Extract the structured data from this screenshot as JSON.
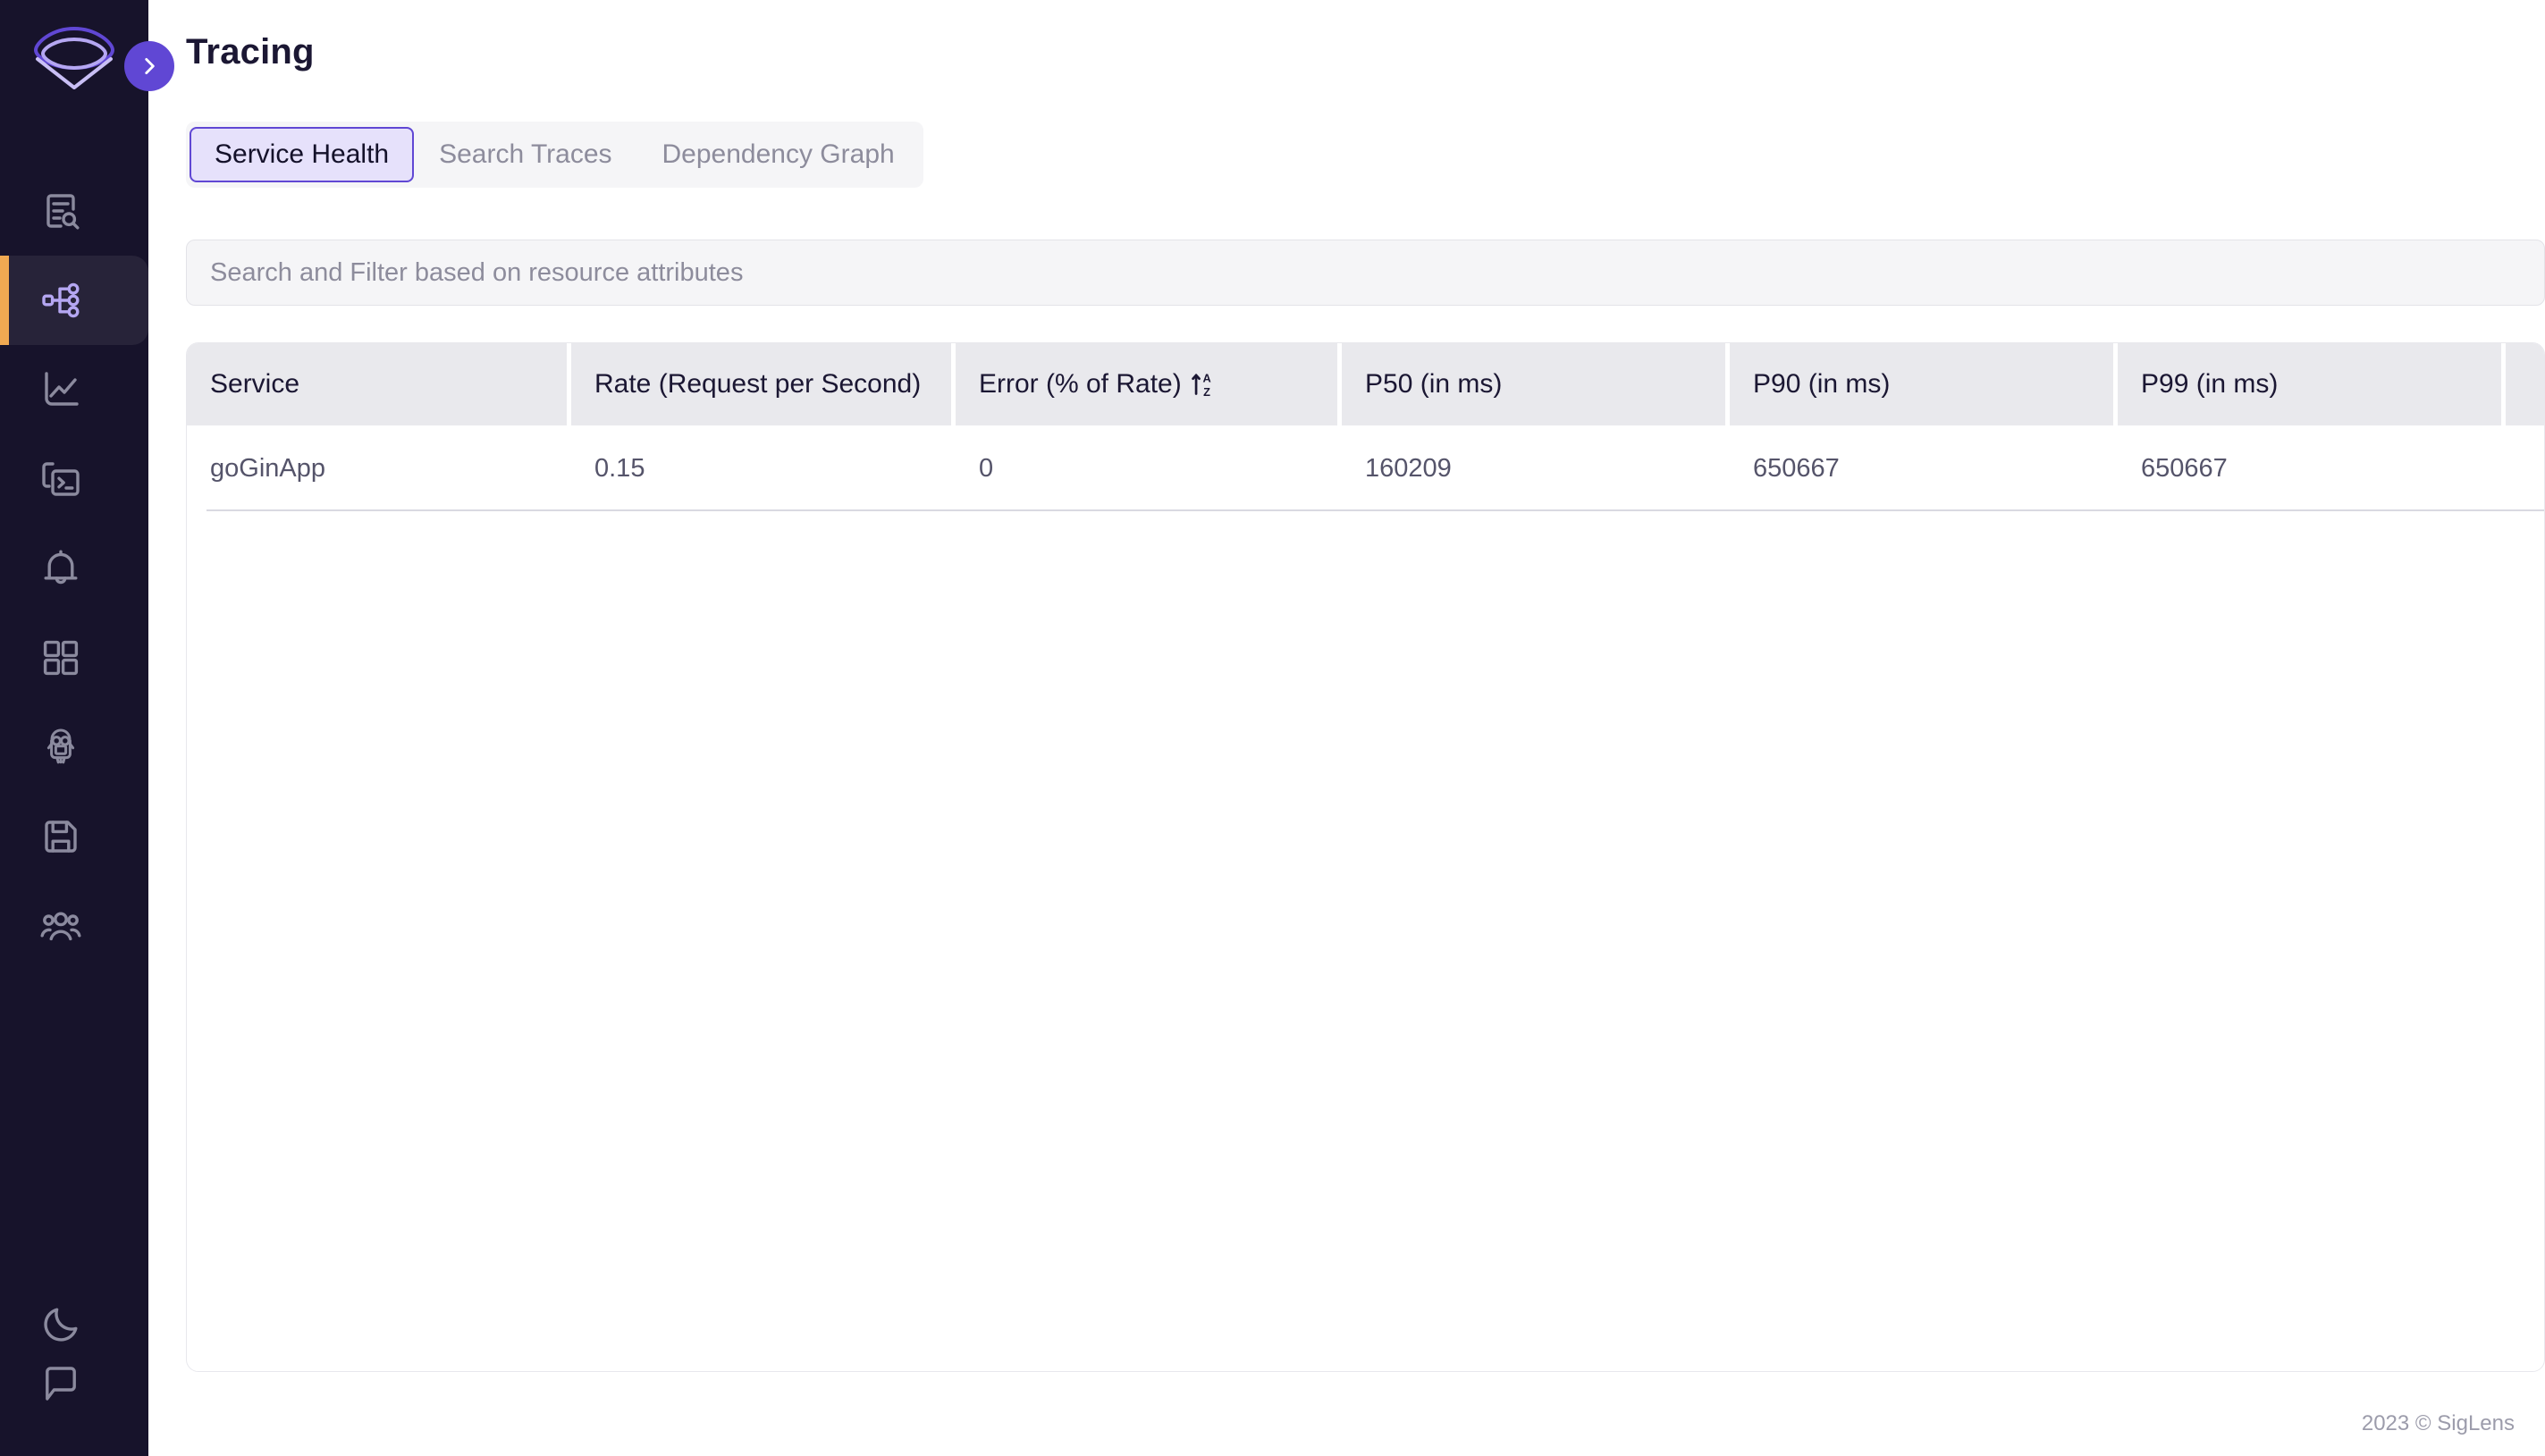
{
  "brand": {
    "logo_name": "siglens-logo",
    "accent_purple": "#6047d4",
    "accent_orange": "#f0a952",
    "sidebar_bg": "#17132b"
  },
  "sidebar": {
    "toggle_icon": "chevron-right-icon",
    "items": [
      {
        "icon": "log-search-icon",
        "name": "sidebar-item-logs",
        "active": false
      },
      {
        "icon": "tracing-nodes-icon",
        "name": "sidebar-item-tracing",
        "active": true
      },
      {
        "icon": "line-chart-icon",
        "name": "sidebar-item-metrics",
        "active": false
      },
      {
        "icon": "terminal-window-icon",
        "name": "sidebar-item-query",
        "active": false
      },
      {
        "icon": "bell-icon",
        "name": "sidebar-item-alerts",
        "active": false
      },
      {
        "icon": "grid-squares-icon",
        "name": "sidebar-item-dashboards",
        "active": false
      },
      {
        "icon": "minion-icon",
        "name": "sidebar-item-minion",
        "active": false
      },
      {
        "icon": "floppy-disk-icon",
        "name": "sidebar-item-saved-queries",
        "active": false
      },
      {
        "icon": "users-group-icon",
        "name": "sidebar-item-users",
        "active": false
      }
    ],
    "bottom_items": [
      {
        "icon": "moon-icon",
        "name": "sidebar-item-dark-mode"
      },
      {
        "icon": "chat-bubble-icon",
        "name": "sidebar-item-support"
      }
    ]
  },
  "header": {
    "title": "Tracing"
  },
  "tabs": [
    {
      "label": "Service Health",
      "active": true
    },
    {
      "label": "Search Traces",
      "active": false
    },
    {
      "label": "Dependency Graph",
      "active": false
    }
  ],
  "search": {
    "value": "",
    "placeholder": "Search and Filter based on resource attributes"
  },
  "table": {
    "columns": [
      {
        "label": "Service",
        "sorted": false
      },
      {
        "label": "Rate (Request per Second)",
        "sorted": false
      },
      {
        "label": "Error (% of Rate)",
        "sorted": true,
        "sort_icon": "sort-az-ascending-icon"
      },
      {
        "label": "P50 (in ms)",
        "sorted": false
      },
      {
        "label": "P90 (in ms)",
        "sorted": false
      },
      {
        "label": "P99 (in ms)",
        "sorted": false
      }
    ],
    "rows": [
      {
        "service": "goGinApp",
        "rate": "0.15",
        "error": "0",
        "p50": "160209",
        "p90": "650667",
        "p99": "650667"
      }
    ]
  },
  "footer": {
    "copyright": "2023 © SigLens"
  }
}
